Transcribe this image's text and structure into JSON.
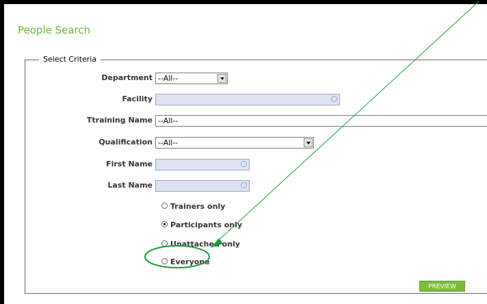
{
  "page": {
    "title": "People Search"
  },
  "criteria": {
    "legend": "Select Criteria",
    "fields": {
      "department": {
        "label": "Department",
        "value": "--All--"
      },
      "facility": {
        "label": "Facility",
        "value": ""
      },
      "training_name": {
        "label": "Ttraining Name",
        "value": "--All--"
      },
      "qualification": {
        "label": "Qualification",
        "value": "--All--"
      },
      "first_name": {
        "label": "First Name",
        "value": ""
      },
      "last_name": {
        "label": "Last Name",
        "value": ""
      }
    },
    "radios": [
      {
        "label": "Trainers only",
        "checked": false
      },
      {
        "label": "Participants only",
        "checked": true
      },
      {
        "label": "Unattached only",
        "checked": false
      },
      {
        "label": "Everyone",
        "checked": false
      }
    ],
    "preview_label": "PREVIEW"
  },
  "colors": {
    "accent_green": "#6db33f",
    "annotation_green": "#1a9a3a",
    "button_green": "#7bbd3b",
    "textbox_fill": "#dde3f0"
  }
}
